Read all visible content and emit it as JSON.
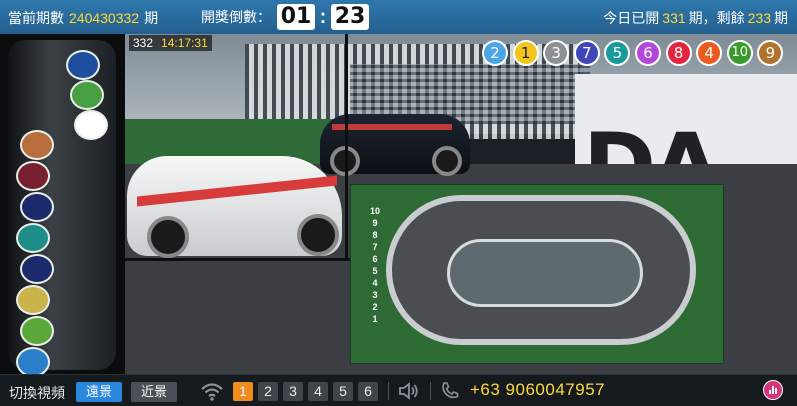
{
  "header": {
    "issue_label": "當前期數",
    "issue_number": "240430332",
    "issue_suffix": "期",
    "countdown_label": "開獎倒數：",
    "countdown_minutes": "01",
    "countdown_seconds": "23",
    "countdown_colon": ":",
    "today_prefix": "今日已開",
    "today_opened": "331",
    "today_middle": "期，剩餘",
    "today_remaining": "233",
    "today_suffix": "期"
  },
  "video": {
    "round": "332",
    "clock": "14:17:31",
    "brand_text": "DA",
    "lane_numbers": [
      "10",
      "9",
      "8",
      "7",
      "6",
      "5",
      "4",
      "3",
      "2",
      "1"
    ],
    "result_balls": [
      {
        "num": "2",
        "color": "#4aa6e8"
      },
      {
        "num": "1",
        "color": "#f3c51c"
      },
      {
        "num": "3",
        "color": "#8e9193"
      },
      {
        "num": "7",
        "color": "#3f46b9"
      },
      {
        "num": "5",
        "color": "#1a9a9a"
      },
      {
        "num": "6",
        "color": "#b248d8"
      },
      {
        "num": "8",
        "color": "#e3263f"
      },
      {
        "num": "4",
        "color": "#ec5a21"
      },
      {
        "num": "10",
        "color": "#3a9b2c"
      },
      {
        "num": "9",
        "color": "#b0722d"
      }
    ],
    "tube_balls": [
      {
        "color": "#1e4f9e"
      },
      {
        "color": "#46a042"
      },
      {
        "color": "#ffffff"
      },
      {
        "color": "#b86e3c"
      },
      {
        "color": "#7a1f2f"
      },
      {
        "color": "#1a2a6b"
      },
      {
        "color": "#1f8d8a"
      },
      {
        "color": "#1a2a6b"
      },
      {
        "color": "#c9b34a"
      },
      {
        "color": "#5aa83a"
      },
      {
        "color": "#2a7fc8"
      }
    ]
  },
  "footer": {
    "switch_label": "切換視頻",
    "far_view": "遠景",
    "near_view": "近景",
    "cameras": [
      "1",
      "2",
      "3",
      "4",
      "5",
      "6"
    ],
    "phone": "+63 9060047957"
  },
  "colors": {
    "accent_yellow": "#ffd93b",
    "top_bar": "#2f78ad",
    "active_blue": "#2b87de",
    "active_orange": "#f28b1d"
  }
}
